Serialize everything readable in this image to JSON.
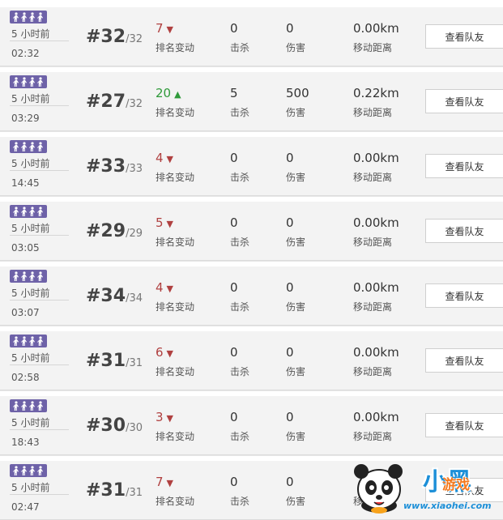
{
  "labels": {
    "rank_change": "排名变动",
    "kills": "击杀",
    "damage": "伤害",
    "distance": "移动距离",
    "view_team": "查看队友"
  },
  "mode_badge_icon": "four-players-icon",
  "colors": {
    "badge": "#6e62a8",
    "rank_down": "#b04040",
    "rank_up": "#2f9a3a",
    "row_bg": "#f3f3f3"
  },
  "matches": [
    {
      "time_ago": "5 小时前",
      "duration": "02:32",
      "rank": "#32",
      "total": "/32",
      "change": "7",
      "direction": "down",
      "kills": "0",
      "damage": "0",
      "distance": "0.00km"
    },
    {
      "time_ago": "5 小时前",
      "duration": "03:29",
      "rank": "#27",
      "total": "/32",
      "change": "20",
      "direction": "up",
      "kills": "5",
      "damage": "500",
      "distance": "0.22km"
    },
    {
      "time_ago": "5 小时前",
      "duration": "14:45",
      "rank": "#33",
      "total": "/33",
      "change": "4",
      "direction": "down",
      "kills": "0",
      "damage": "0",
      "distance": "0.00km"
    },
    {
      "time_ago": "5 小时前",
      "duration": "03:05",
      "rank": "#29",
      "total": "/29",
      "change": "5",
      "direction": "down",
      "kills": "0",
      "damage": "0",
      "distance": "0.00km"
    },
    {
      "time_ago": "5 小时前",
      "duration": "03:07",
      "rank": "#34",
      "total": "/34",
      "change": "4",
      "direction": "down",
      "kills": "0",
      "damage": "0",
      "distance": "0.00km"
    },
    {
      "time_ago": "5 小时前",
      "duration": "02:58",
      "rank": "#31",
      "total": "/31",
      "change": "6",
      "direction": "down",
      "kills": "0",
      "damage": "0",
      "distance": "0.00km"
    },
    {
      "time_ago": "5 小时前",
      "duration": "18:43",
      "rank": "#30",
      "total": "/30",
      "change": "3",
      "direction": "down",
      "kills": "0",
      "damage": "0",
      "distance": "0.00km"
    },
    {
      "time_ago": "5 小时前",
      "duration": "02:47",
      "rank": "#31",
      "total": "/31",
      "change": "7",
      "direction": "down",
      "kills": "0",
      "damage": "0",
      "distance": ""
    }
  ],
  "watermark": {
    "logo_text": "小黑",
    "sub_text": "游戏",
    "url": "www.xiaohei.com",
    "icon": "panda-mascot-icon"
  }
}
